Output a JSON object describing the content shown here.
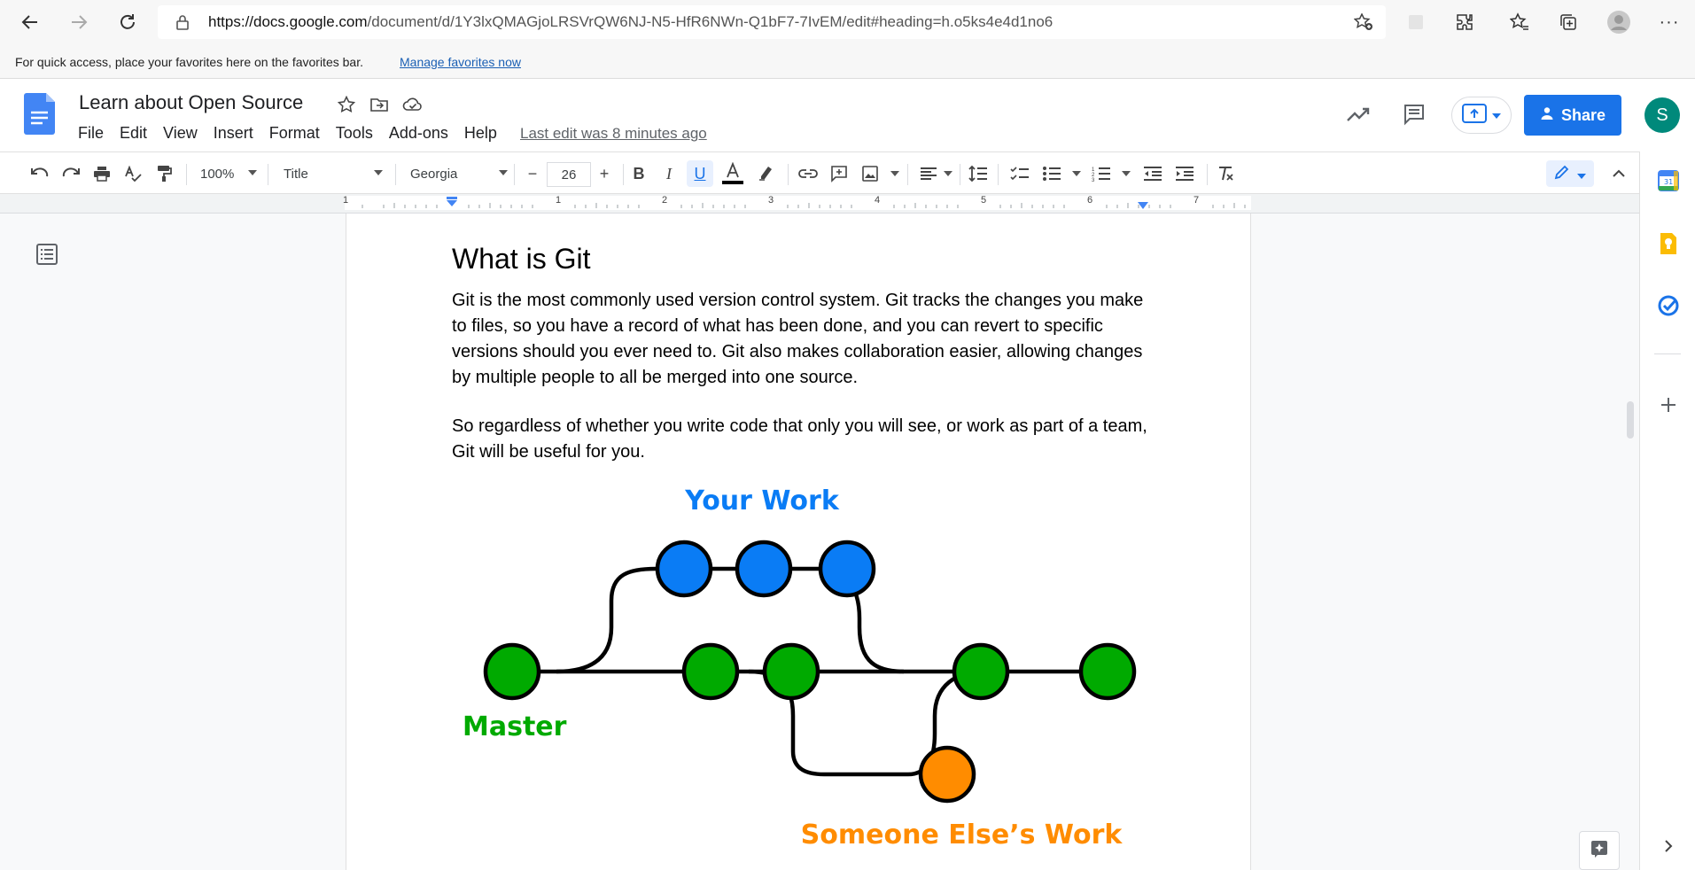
{
  "browser": {
    "url_prefix": "https://docs.google.com",
    "url_path": "/document/d/1Y3lxQMAGjoLRSVrQW6NJ-N5-HfR6NWn-Q1bF7-7IvEM/edit#heading=h.o5ks4e4d1no6",
    "favorites_bar_text": "For quick access, place your favorites here on the favorites bar.",
    "favorites_link": "Manage favorites now"
  },
  "docs": {
    "title": "Learn about Open Source",
    "menu": [
      "File",
      "Edit",
      "View",
      "Insert",
      "Format",
      "Tools",
      "Add-ons",
      "Help"
    ],
    "last_edit": "Last edit was 8 minutes ago",
    "share_label": "Share",
    "avatar_initial": "S"
  },
  "toolbar": {
    "zoom": "100%",
    "style": "Title",
    "font": "Georgia",
    "font_size": "26",
    "minus": "−",
    "plus": "+",
    "text_color": "#000000"
  },
  "ruler": {
    "numbers": [
      "1",
      "1",
      "2",
      "3",
      "4",
      "5",
      "6",
      "7"
    ]
  },
  "content": {
    "heading": "What is Git",
    "para1": "Git is the most commonly used version control system. Git tracks the changes you make to files, so you have a record of what has been done, and you can revert to specific versions should you ever need to. Git also makes collaboration easier, allowing changes by multiple people to all be merged into one source.",
    "para2": "So regardless of whether you write code that only you will see, or work as part of a team, Git will be useful for you."
  },
  "diagram": {
    "label_your_work": "Your Work",
    "label_master": "Master",
    "label_someone_else": "Someone Else’s Work",
    "color_your_work": "#0a7cf5",
    "color_master": "#00aa00",
    "color_someone_else": "#ff8c00"
  }
}
